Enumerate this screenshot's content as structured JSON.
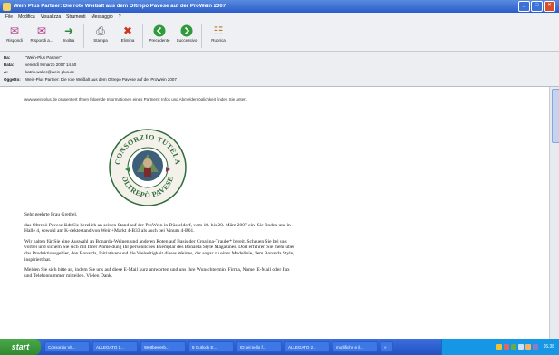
{
  "window": {
    "title": "Wein Plus Partner: Die rote Weißalt aus dem Oltrepò Pavese auf der ProWein 2007"
  },
  "menu": [
    "File",
    "Modifica",
    "Visualizza",
    "Strumenti",
    "Messaggio",
    "?"
  ],
  "toolbar": [
    {
      "label": "Rispondi",
      "icon": "reply-icon"
    },
    {
      "label": "Rispondi a...",
      "icon": "reply-all-icon"
    },
    {
      "label": "Inoltra",
      "icon": "forward-icon"
    },
    {
      "label": "Stampa",
      "icon": "print-icon"
    },
    {
      "label": "Elimina",
      "icon": "delete-icon"
    },
    {
      "label": "Precedente",
      "icon": "previous-icon"
    },
    {
      "label": "Successivo",
      "icon": "next-icon"
    },
    {
      "label": "Rubrica",
      "icon": "address-book-icon"
    }
  ],
  "headers": {
    "from_label": "Da:",
    "from": "\"Wein-Plus Partner\"",
    "date_label": "Data:",
    "date": "venerdì 9 marzo 2007 14.50",
    "to_label": "A:",
    "to": "katrin.walter@wein-plus.de",
    "subject_label": "Oggetto:",
    "subject": "Wein-Plus Partner: Die rote Weißalt aus dem Oltrepò Pavese auf der ProWein 2007"
  },
  "body": {
    "intro": "www.wein-plus.de präsentiert Ihnen folgende Informationen eines Partners: Infos und Abmeldemöglichkeit finden Sie unten.",
    "seal_text_top": "CONSORZIO TUTELA",
    "seal_text_bottom": "OLTREPÒ PAVESE",
    "greeting": "Sehr geehrte Frau Grethel,",
    "p1": "das Oltrepò Pavese lädt Sie herzlich an seinen Stand auf der ProWein in Düsseldorf, vom 18. bis 20. März 2007 ein. Sie finden uns in Halle 4, sowohl am K-dektestand von Wein+Markt 4-B33 als auch bei Vinum 4-B61.",
    "p2": "Wir halten für Sie eine Auswahl an Bonarda-Weinen und anderen Roten auf Basis der Croatina-Traube* bereit. Schauen Sie bei uns vorbei und sichern Sie sich mit Ihrer Anmeldung Ihr persönliches Exemplar des Bonarda Style Magazines. Dort erfahren Sie mehr über das Produktionsgebiet, den Bonarda, Initiativen und die Vielseitigkeit dieses Weines, der sogar zu einer Modelinie, dem Bonarda Style, inspiriert hat.",
    "p3": "Melden Sie sich bitte an, indem Sie uns auf diese E-Mail kurz antworten und uns Ihre Wunschtermin, Firma, Name, E-Mail oder Fax und Telefonnummer mitteilen. Vielen Dank."
  },
  "taskbar": {
    "start": "start",
    "tasks": [
      "Consorzio Vit...",
      "ALLEGATO 1...",
      "Wettbewerb...",
      "8 Outlook E...",
      "ID:sei:nello f...",
      "ALLEGATO 2...",
      "modifiche e il...",
      "»"
    ],
    "clock": "16.38"
  },
  "colors": {
    "titlebar": "#2a5cc8",
    "taskbar": "#2351c0",
    "start": "#2f8a2f"
  }
}
